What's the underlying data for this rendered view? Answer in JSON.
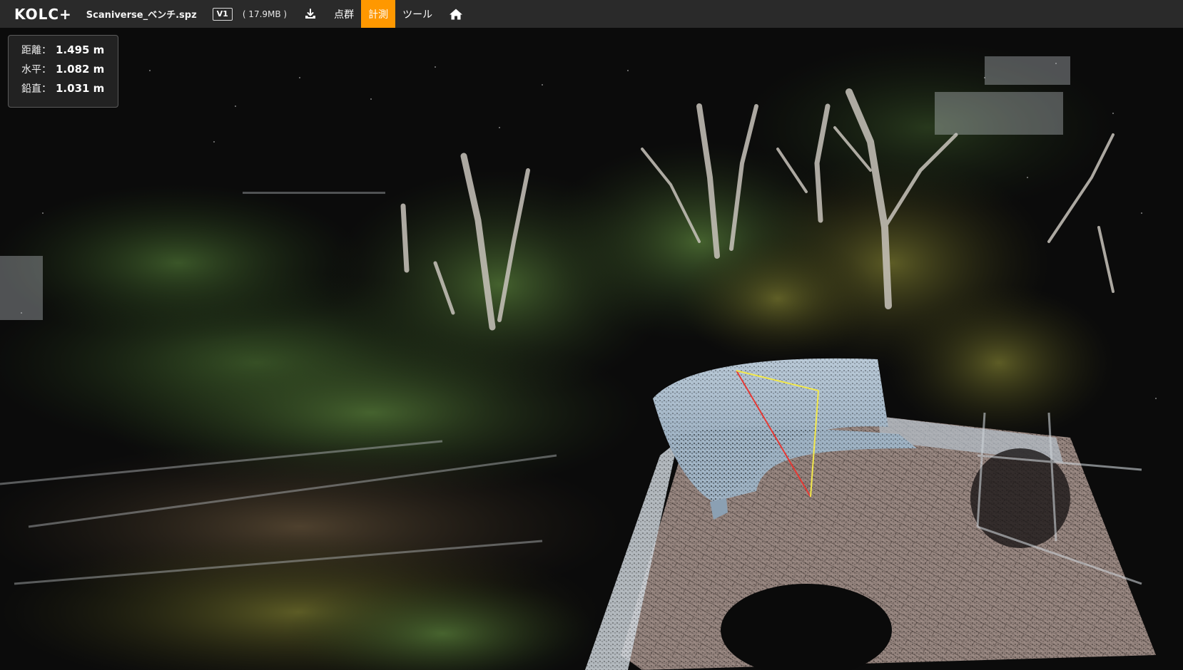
{
  "app": {
    "logo": "KOLC+",
    "filename": "Scaniverse_ベンチ.spz",
    "version": "V1",
    "filesize": "( 17.9MB )"
  },
  "toolbar": {
    "download_icon": "download-tray-icon",
    "home_icon": "home-icon",
    "menu": [
      {
        "label": "点群",
        "active": false
      },
      {
        "label": "計測",
        "active": true
      },
      {
        "label": "ツール",
        "active": false
      }
    ],
    "accent_color": "#ff9800",
    "bar_color": "#2a2a2a"
  },
  "measurement": {
    "rows": [
      {
        "label": "距離：",
        "value": "1.495 m"
      },
      {
        "label": "水平：",
        "value": "1.082 m"
      },
      {
        "label": "鉛直：",
        "value": "1.031 m"
      }
    ],
    "line_colors": {
      "distance": "#e53935",
      "horizontal": "#f2e84a",
      "vertical": "#f2e84a"
    }
  }
}
